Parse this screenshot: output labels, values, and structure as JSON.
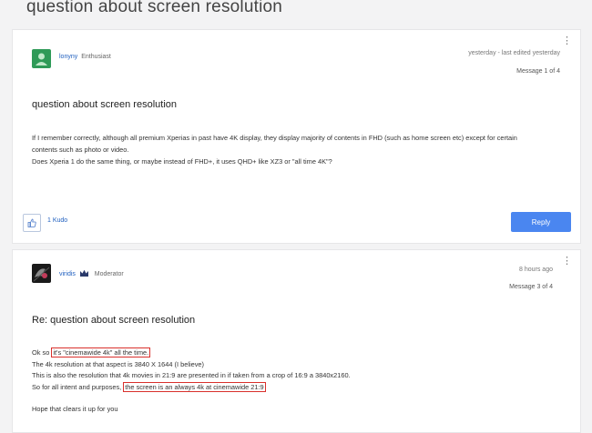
{
  "page": {
    "title": "question about screen resolution"
  },
  "post1": {
    "author": "lonyny",
    "rank": "Enthusiast",
    "date": "yesterday - last edited yesterday",
    "message_index": "Message 1 of 4",
    "subject": "question about screen resolution",
    "body": [
      "If I remember correctly, although all premium Xperias in past have 4K display, they display majority of contents in FHD (such as home screen etc) except for certain contents such as photo or video.",
      "Does Xperia 1 do the same thing, or maybe instead of FHD+, it uses QHD+ like XZ3 or \"all time 4K\"?"
    ],
    "kudos": "1 Kudo",
    "reply_label": "Reply"
  },
  "post2": {
    "author": "viridis",
    "rank": "Moderator",
    "date": "8 hours ago",
    "message_index": "Message 3 of 4",
    "subject": "Re: question about screen resolution",
    "line1_prefix": "Ok so ",
    "line1_highlight": "it's \"cinemawide 4k\" all the time.",
    "line2": "The 4k resolution at that aspect is 3840 X 1644 (I believe)",
    "line3": "This is also the resolution that 4k movies in 21:9 are presented in if taken from a crop of 16:9 a 3840x2160.",
    "line4_prefix": "So for all intent and purposes, ",
    "line4_highlight": "the screen is an always 4k at cinemawide 21:9",
    "closing": "Hope that clears it up for you"
  },
  "colors": {
    "accent": "#4a86f0",
    "link": "#1f5fbf",
    "highlight_border": "#d9302c"
  },
  "icons": {
    "menu": "kebab-menu-icon",
    "kudo": "thumbs-up-icon",
    "rank": "crown-icon"
  }
}
